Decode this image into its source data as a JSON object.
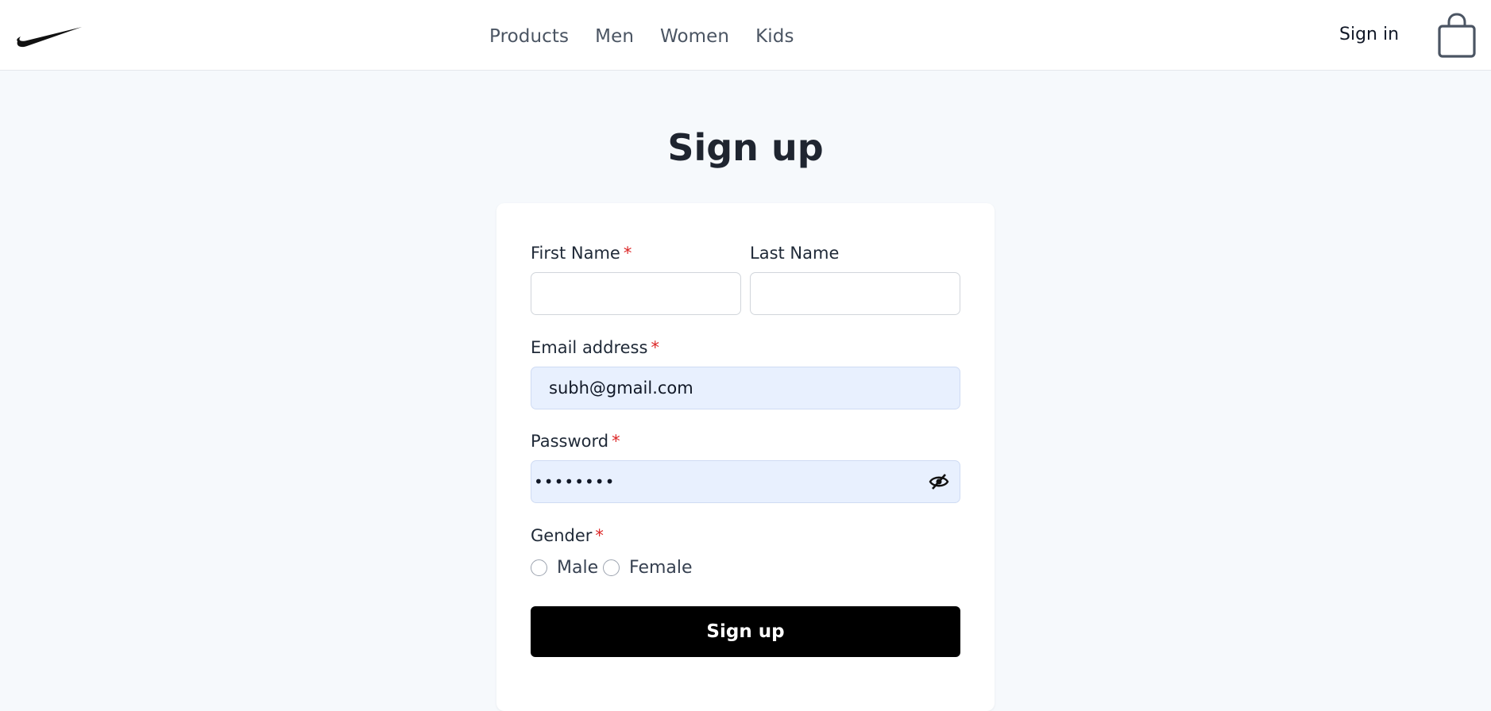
{
  "header": {
    "logo_icon": "swoosh-logo-icon",
    "nav": [
      {
        "label": "Products"
      },
      {
        "label": "Men"
      },
      {
        "label": "Women"
      },
      {
        "label": "Kids"
      }
    ],
    "signin_label": "Sign in",
    "bag_icon": "shopping-bag-icon"
  },
  "page": {
    "title": "Sign up"
  },
  "form": {
    "first_name": {
      "label": "First Name",
      "required_mark": "*",
      "value": ""
    },
    "last_name": {
      "label": "Last Name",
      "value": ""
    },
    "email": {
      "label": "Email address",
      "required_mark": "*",
      "value": "subh@gmail.com"
    },
    "password": {
      "label": "Password",
      "required_mark": "*",
      "masked_value": "••••••••",
      "toggle_icon": "eye-off-icon"
    },
    "gender": {
      "label": "Gender",
      "required_mark": "*",
      "options": [
        {
          "label": "Male",
          "selected": false
        },
        {
          "label": "Female",
          "selected": false
        }
      ]
    },
    "submit_label": "Sign up"
  },
  "colors": {
    "background": "#f6f9fc",
    "card": "#ffffff",
    "required": "#dc2626",
    "filled_input": "#e8f0fe",
    "button": "#000000",
    "nav_text": "#4b5563"
  }
}
